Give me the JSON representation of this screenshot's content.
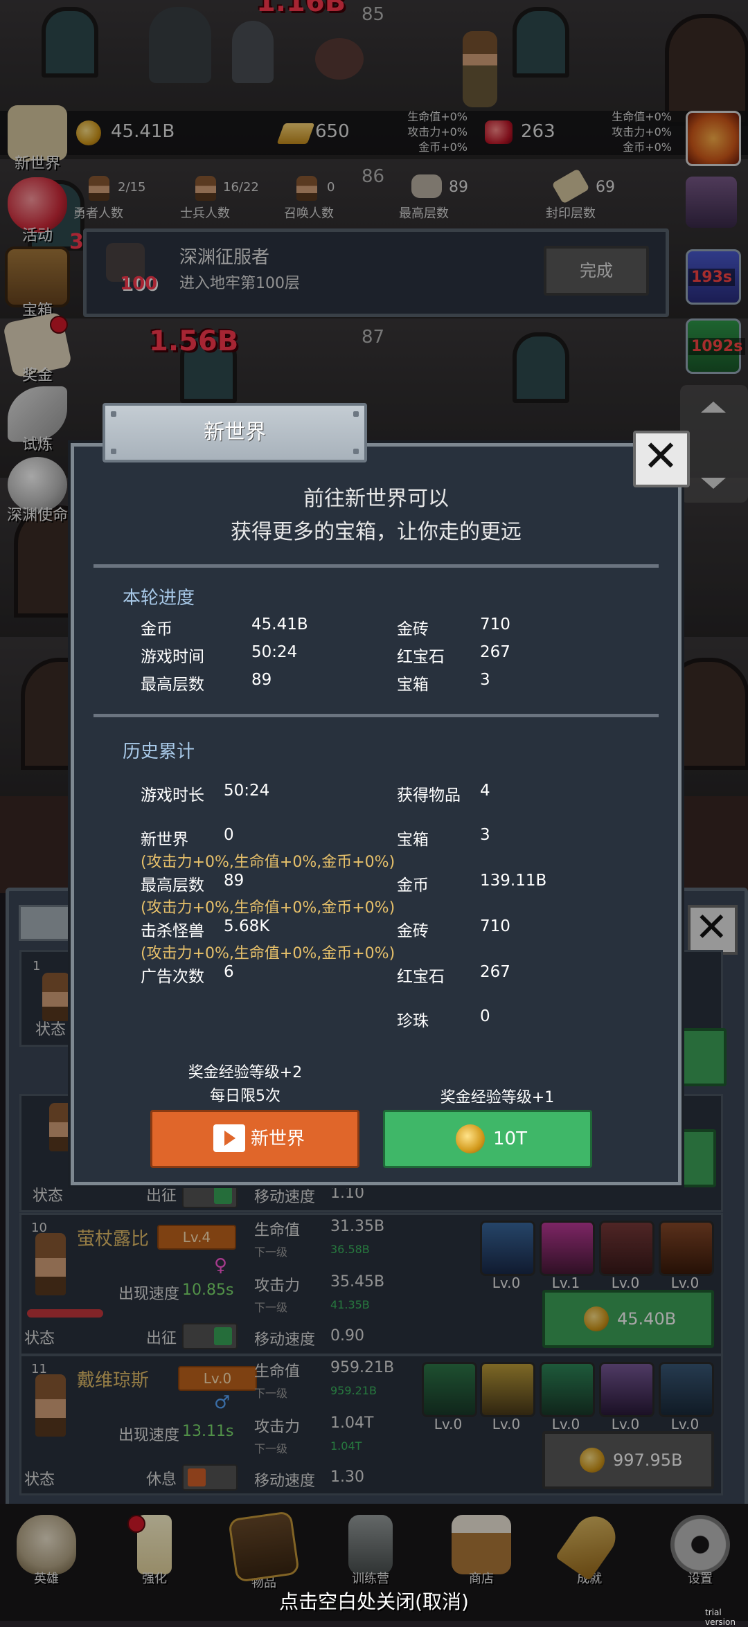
{
  "scene": {
    "floors": [
      "85",
      "86",
      "87"
    ],
    "damage_texts": [
      "1.16B",
      "1.56B"
    ]
  },
  "resources": {
    "coins": "45.41B",
    "gold_bars": "650",
    "rubies": "263",
    "left_bonus": [
      "生命值+0%",
      "攻击力+0%",
      "金币+0%"
    ],
    "right_bonus": [
      "生命值+0%",
      "攻击力+0%",
      "金币+0%"
    ]
  },
  "stats": [
    {
      "value": "2/15",
      "label": "勇者人数"
    },
    {
      "value": "16/22",
      "label": "士兵人数"
    },
    {
      "value": "0",
      "label": "召唤人数"
    },
    {
      "value": "89",
      "label": "最高层数"
    },
    {
      "value": "69",
      "label": "封印层数"
    }
  ],
  "left_menu": [
    {
      "label": "新世界",
      "icon": "scroll-icon"
    },
    {
      "label": "活动",
      "icon": "heart-icon",
      "badge": "3"
    },
    {
      "label": "宝箱",
      "icon": "chest-icon"
    },
    {
      "label": "奖金",
      "icon": "letter-icon"
    },
    {
      "label": "试炼",
      "icon": "feather-icon"
    },
    {
      "label": "深渊使命",
      "icon": "orb-icon"
    }
  ],
  "right_column": {
    "timers": [
      "193s",
      "1092s"
    ]
  },
  "quest": {
    "title": "深渊征服者",
    "description": "进入地牢第100层",
    "badge": "100",
    "button": "完成"
  },
  "heroes": [
    {
      "index": "1",
      "status_label": "状态"
    },
    {
      "status_label": "状态",
      "deploy_label": "出征",
      "move_label": "移动速度",
      "move_value": "1.10"
    },
    {
      "index": "10",
      "name": "萤杖露比",
      "level": "Lv.4",
      "speed_label": "出现速度",
      "speed": "10.85s",
      "status_label": "状态",
      "deploy_label": "出征",
      "hp_label": "生命值",
      "hp": "31.35B",
      "next_label": "下一级",
      "hp_next": "36.58B",
      "atk_label": "攻击力",
      "atk": "35.45B",
      "atk_next": "41.35B",
      "move_label": "移动速度",
      "move_value": "0.90",
      "skills": [
        "Lv.0",
        "Lv.1",
        "Lv.0",
        "Lv.0"
      ],
      "upgrade_cost": "45.40B"
    },
    {
      "index": "11",
      "name": "戴维琼斯",
      "level": "Lv.0",
      "speed_label": "出现速度",
      "speed": "13.11s",
      "status_label": "状态",
      "deploy_label": "休息",
      "hp_label": "生命值",
      "hp": "959.21B",
      "next_label": "下一级",
      "hp_next": "959.21B",
      "atk_label": "攻击力",
      "atk": "1.04T",
      "atk_next": "1.04T",
      "move_label": "移动速度",
      "move_value": "1.30",
      "skills": [
        "Lv.0",
        "Lv.0",
        "Lv.0",
        "Lv.0",
        "Lv.0"
      ],
      "upgrade_cost": "997.95B"
    }
  ],
  "dialog": {
    "tab_title": "新世界",
    "intro_line1": "前往新世界可以",
    "intro_line2": "获得更多的宝箱，让你走的更远",
    "round_title": "本轮进度",
    "round": [
      {
        "label": "金币",
        "value": "45.41B"
      },
      {
        "label": "金砖",
        "value": "710"
      },
      {
        "label": "游戏时间",
        "value": "50:24"
      },
      {
        "label": "红宝石",
        "value": "267"
      },
      {
        "label": "最高层数",
        "value": "89"
      },
      {
        "label": "宝箱",
        "value": "3"
      }
    ],
    "history_title": "历史累计",
    "history": {
      "playtime_label": "游戏时长",
      "playtime": "50:24",
      "items_label": "获得物品",
      "items": "4",
      "newworld_label": "新世界",
      "newworld": "0",
      "newworld_bonus": "(攻击力+0%,生命值+0%,金币+0%)",
      "chest_label": "宝箱",
      "chest": "3",
      "maxfloor_label": "最高层数",
      "maxfloor": "89",
      "maxfloor_bonus": "(攻击力+0%,生命值+0%,金币+0%)",
      "coins_label": "金币",
      "coins": "139.11B",
      "kills_label": "击杀怪兽",
      "kills": "5.68K",
      "kills_bonus": "(攻击力+0%,生命值+0%,金币+0%)",
      "goldbar_label": "金砖",
      "goldbar": "710",
      "ads_label": "广告次数",
      "ads": "6",
      "ruby_label": "红宝石",
      "ruby": "267",
      "pearl_label": "珍珠",
      "pearl": "0"
    },
    "ad_button": {
      "caption1": "奖金经验等级+2",
      "caption2": "每日限5次",
      "label": "新世界"
    },
    "coin_button": {
      "caption": "奖金经验等级+1",
      "label": "10T"
    },
    "colors": {
      "orange": "#e0662a",
      "green": "#3fb768"
    }
  },
  "bottom_nav": [
    {
      "label": "英雄",
      "icon": "skull-icon"
    },
    {
      "label": "强化",
      "icon": "candle-icon",
      "dot": true
    },
    {
      "label": "物品",
      "icon": "book-icon"
    },
    {
      "label": "训练营",
      "icon": "lantern-icon"
    },
    {
      "label": "商店",
      "icon": "mug-icon"
    },
    {
      "label": "成就",
      "icon": "key-icon"
    },
    {
      "label": "设置",
      "icon": "gear-icon"
    }
  ],
  "close_hint": "点击空白处关闭(取消)",
  "trial_label": "trial version"
}
